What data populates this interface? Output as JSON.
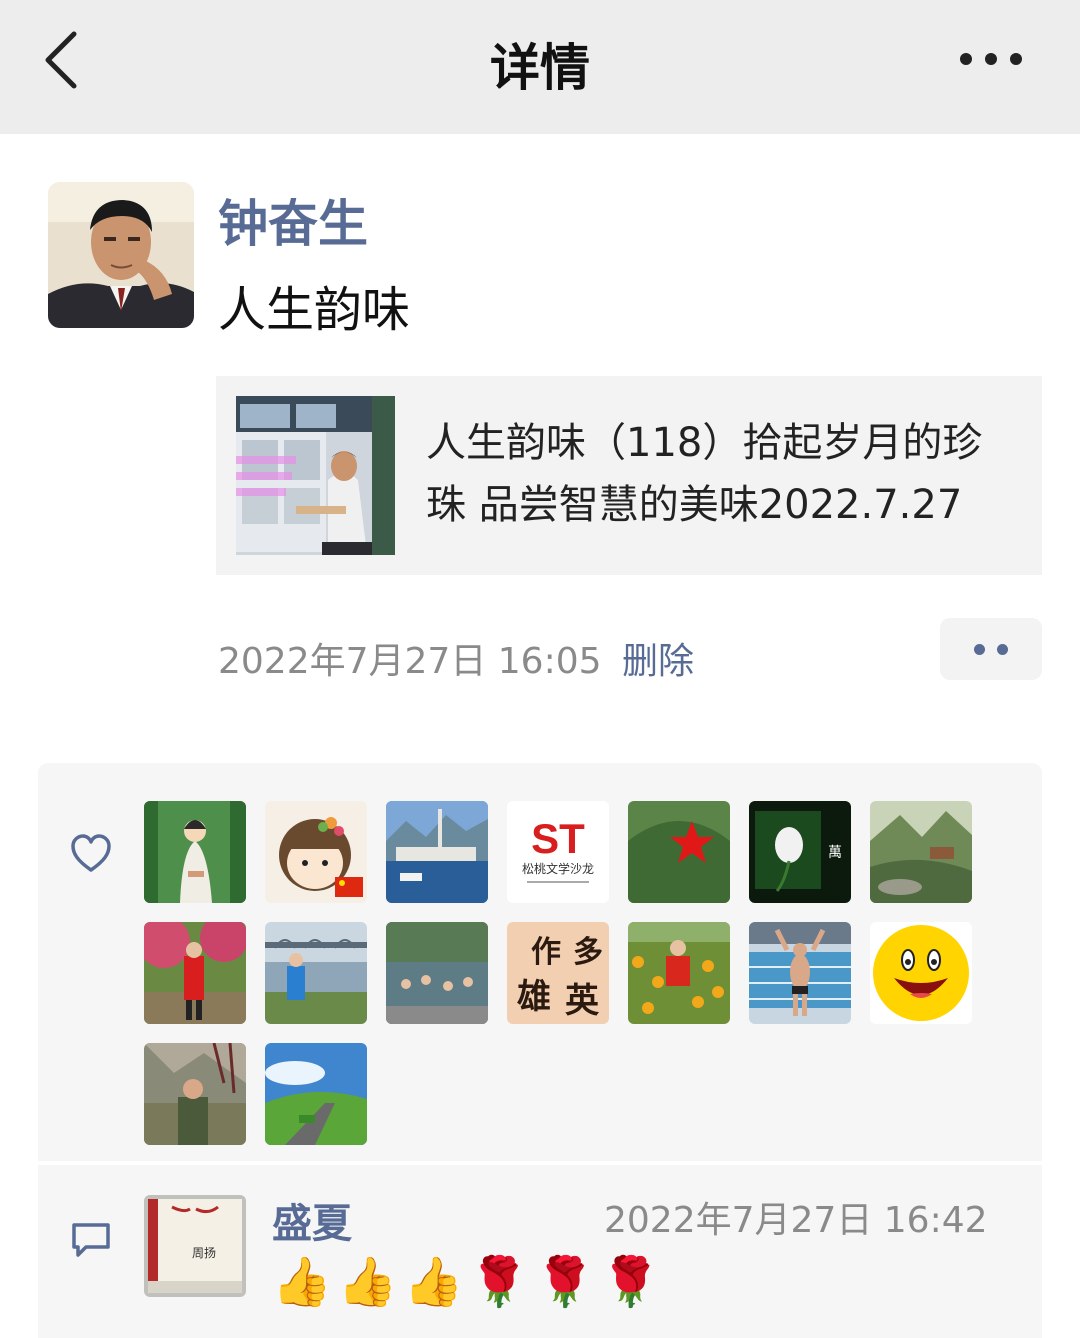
{
  "nav": {
    "title": "详情",
    "back_icon": "chevron-left-icon",
    "more_icon": "more-horizontal-icon"
  },
  "post": {
    "author": "钟奋生",
    "text": "人生韵味",
    "link": {
      "title": "人生韵味（118）拾起岁月的珍珠 品尝智慧的美味2022.7.27"
    },
    "time": "2022年7月27日 16:05",
    "delete_label": "删除"
  },
  "likes": {
    "icon": "heart-icon",
    "avatars": [
      {
        "name": "like-avatar-1",
        "theme": "guanyin",
        "color": "#5a9a56"
      },
      {
        "name": "like-avatar-2",
        "theme": "cartoon-girl",
        "color": "#f3ead9"
      },
      {
        "name": "like-avatar-3",
        "theme": "lake-town",
        "color": "#5a84b8"
      },
      {
        "name": "like-avatar-4",
        "theme": "st-logo",
        "text": "ST",
        "sub": "松桃文学沙龙",
        "color": "#ffffff"
      },
      {
        "name": "like-avatar-5",
        "theme": "green-cap-red-star",
        "color": "#4f7a40"
      },
      {
        "name": "like-avatar-6",
        "theme": "dark-flower",
        "color": "#0d2510"
      },
      {
        "name": "like-avatar-7",
        "theme": "mountain-valley",
        "color": "#8a9a70"
      },
      {
        "name": "like-avatar-8",
        "theme": "red-coat-woman",
        "color": "#5f7a3a"
      },
      {
        "name": "like-avatar-9",
        "theme": "bridge-river",
        "color": "#9fb0c0"
      },
      {
        "name": "like-avatar-10",
        "theme": "swimming-river",
        "color": "#4d6870"
      },
      {
        "name": "like-avatar-11",
        "theme": "calligraphy",
        "color": "#f0d0b0"
      },
      {
        "name": "like-avatar-12",
        "theme": "flower-field",
        "color": "#d8a020"
      },
      {
        "name": "like-avatar-13",
        "theme": "swimmer-pool",
        "color": "#9ab8cc"
      },
      {
        "name": "like-avatar-14",
        "theme": "smiley",
        "color": "#ffd400"
      },
      {
        "name": "like-avatar-15",
        "theme": "man-outdoors",
        "color": "#7a7a6a"
      },
      {
        "name": "like-avatar-16",
        "theme": "green-road",
        "color": "#4a8ac8"
      }
    ]
  },
  "comments": {
    "icon": "comment-icon",
    "items": [
      {
        "author": "盛夏",
        "time": "2022年7月27日 16:42",
        "emojis": [
          "👍",
          "👍",
          "👍",
          "🌹",
          "🌹",
          "🌹"
        ]
      }
    ]
  }
}
